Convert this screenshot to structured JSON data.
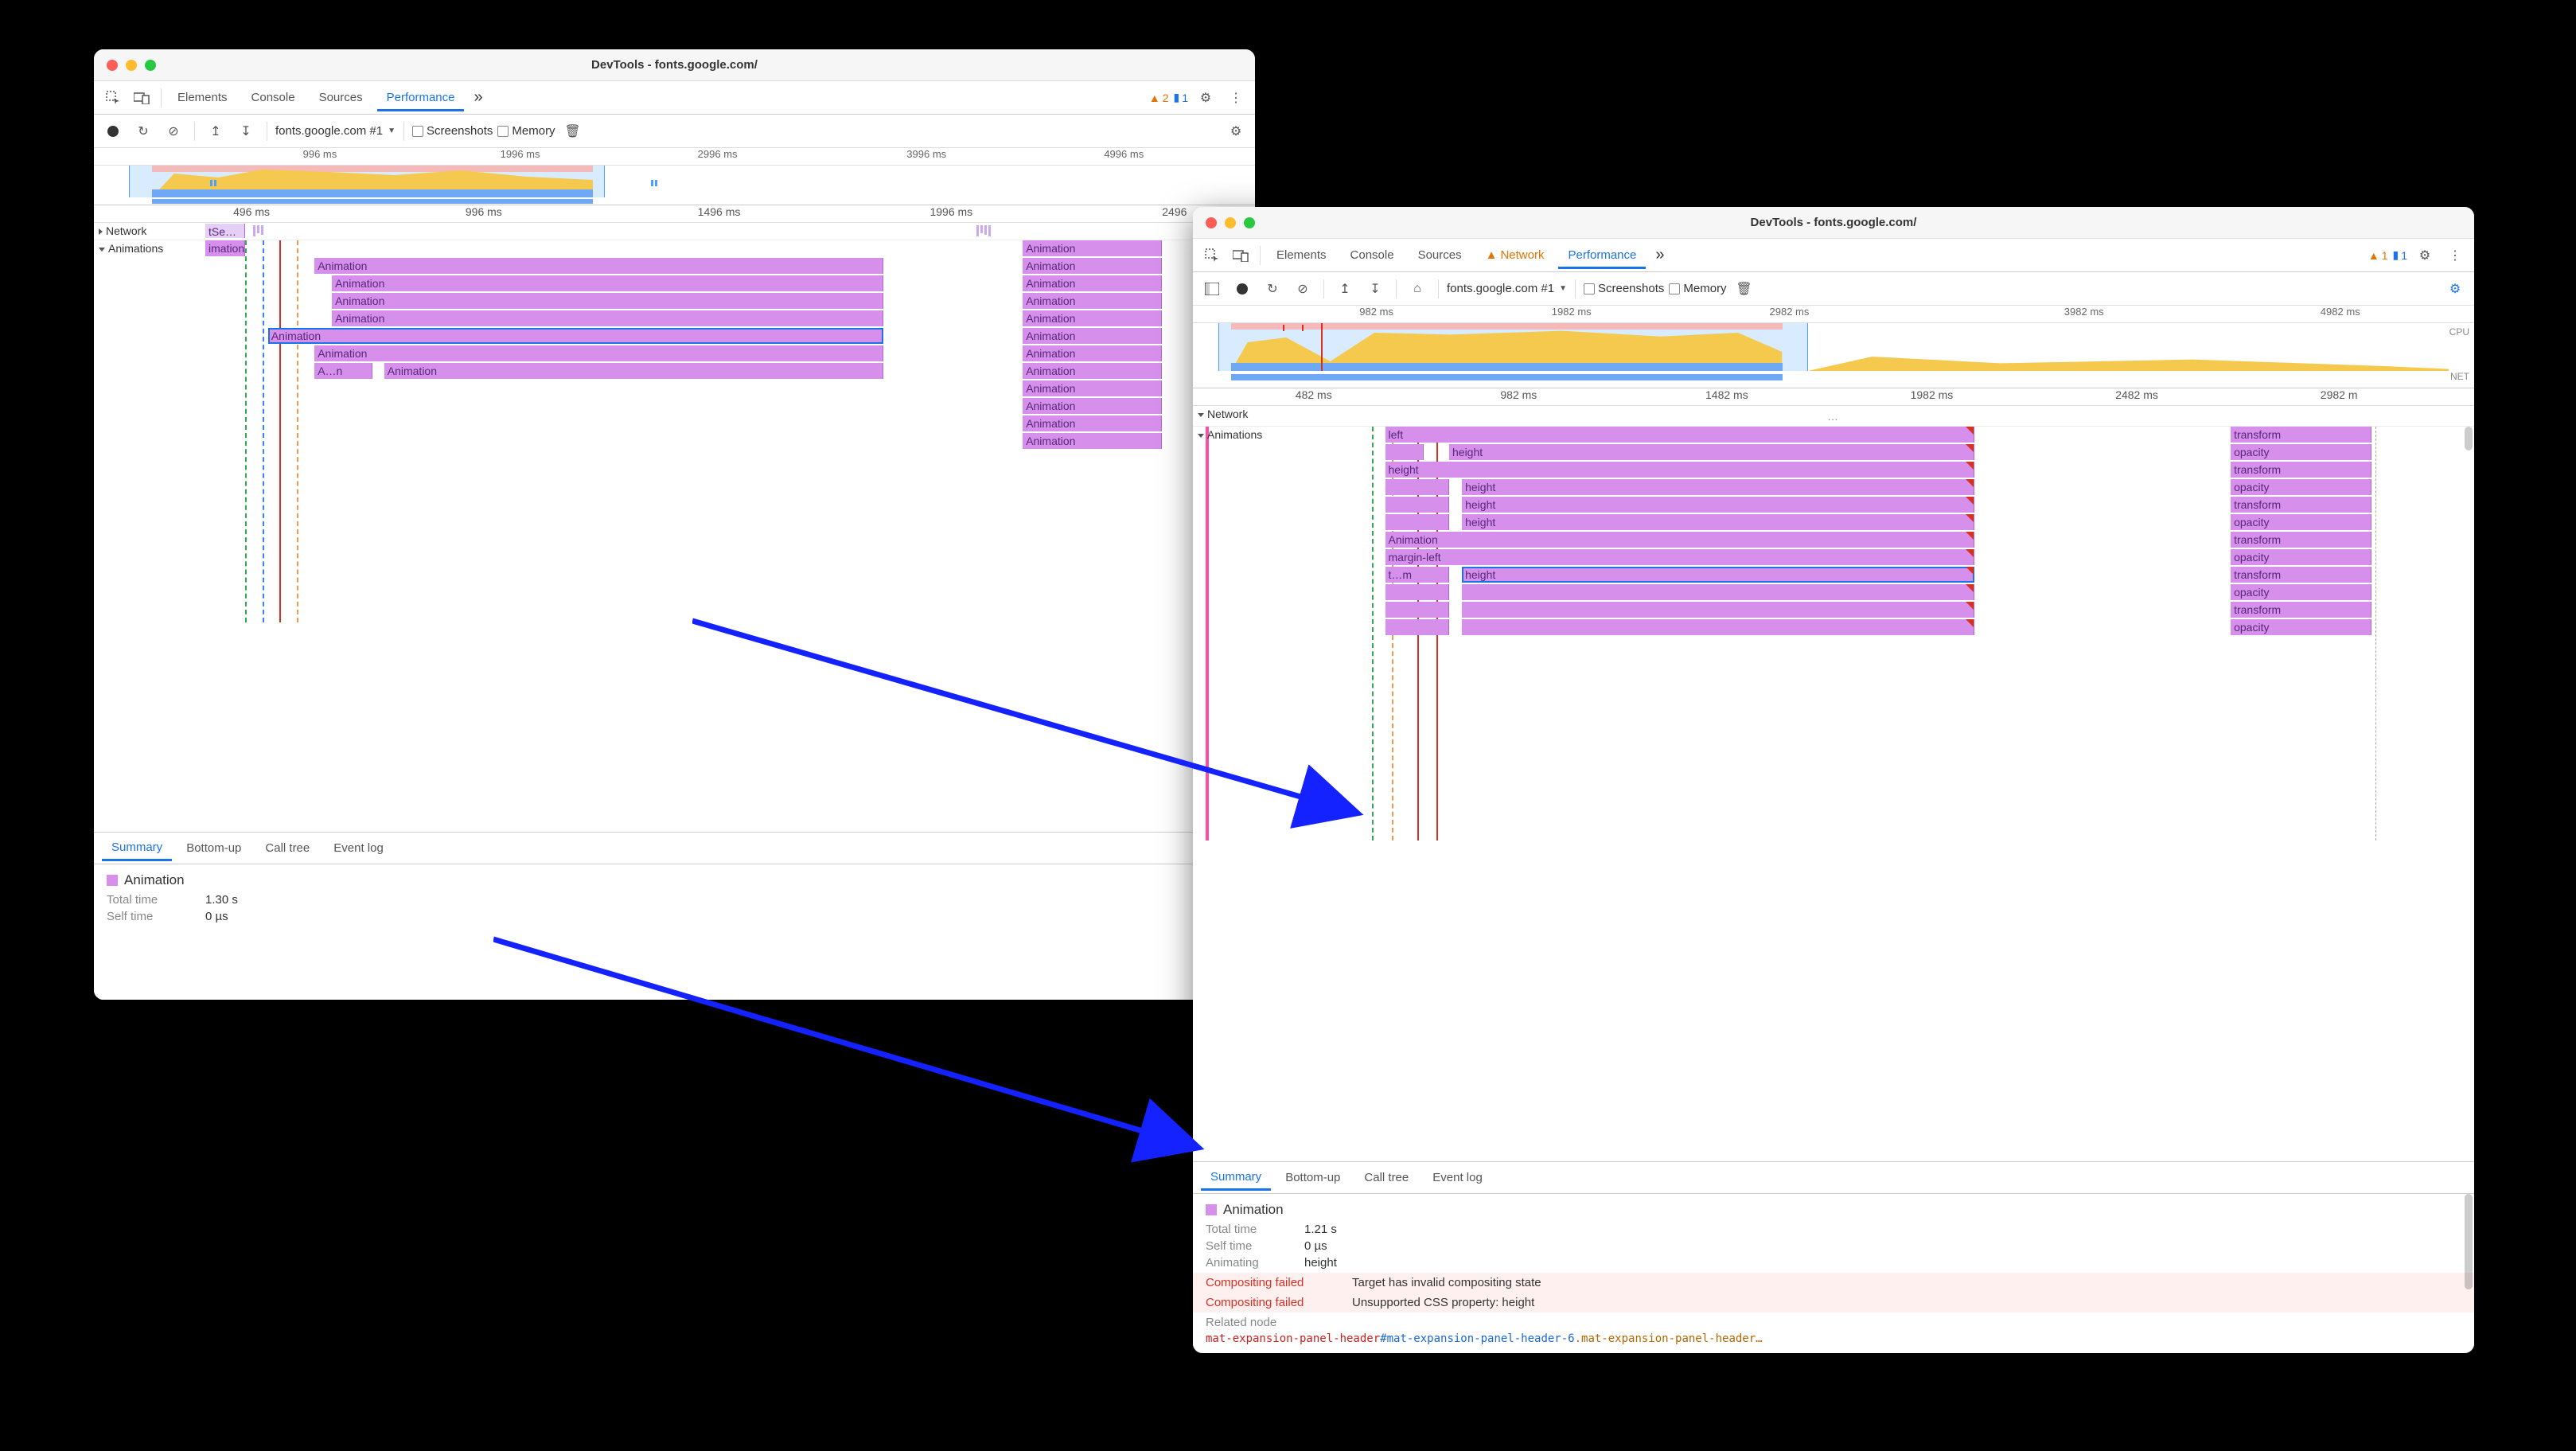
{
  "windows": {
    "left": {
      "title": "DevTools - fonts.google.com/",
      "tabs": {
        "elements": "Elements",
        "console": "Console",
        "sources": "Sources",
        "performance": "Performance",
        "more": "»"
      },
      "warn_count": "2",
      "chat_count": "1",
      "toolbar": {
        "profile": "fonts.google.com #1",
        "screenshots": "Screenshots",
        "memory": "Memory"
      },
      "overview_ruler": [
        "996 ms",
        "1996 ms",
        "2996 ms",
        "3996 ms",
        "4996 ms"
      ],
      "main_ruler": [
        "496 ms",
        "996 ms",
        "1496 ms",
        "1996 ms",
        "2496"
      ],
      "tracks": {
        "network": "Network",
        "net_item": "tSe…",
        "animations": "Animations",
        "anim_hdr_tail": "imation"
      },
      "anim_generic": "Animation",
      "anim_short": "A…n",
      "detail_tabs": {
        "summary": "Summary",
        "bottom": "Bottom-up",
        "calltree": "Call tree",
        "eventlog": "Event log"
      },
      "detail": {
        "title": "Animation",
        "total_k": "Total time",
        "total_v": "1.30 s",
        "self_k": "Self time",
        "self_v": "0 µs"
      }
    },
    "right": {
      "title": "DevTools - fonts.google.com/",
      "tabs": {
        "elements": "Elements",
        "console": "Console",
        "sources": "Sources",
        "network": "Network",
        "performance": "Performance",
        "more": "»"
      },
      "warn_count": "1",
      "chat_count": "1",
      "toolbar": {
        "profile": "fonts.google.com #1",
        "screenshots": "Screenshots",
        "memory": "Memory"
      },
      "overview_ruler": [
        "982 ms",
        "1982 ms",
        "2982 ms",
        "3982 ms",
        "4982 ms"
      ],
      "overview_labels": {
        "cpu": "CPU",
        "net": "NET"
      },
      "main_ruler": [
        "482 ms",
        "982 ms",
        "1482 ms",
        "1982 ms",
        "2482 ms",
        "2982 m"
      ],
      "tracks": {
        "network": "Network",
        "animations": "Animations"
      },
      "anim_rows_left": [
        "left",
        "height",
        "height",
        "height",
        "height",
        "height",
        "Animation",
        "margin-left",
        "t…m",
        "height"
      ],
      "anim_rows_right": [
        "transform",
        "opacity",
        "transform",
        "opacity",
        "transform",
        "opacity",
        "transform",
        "opacity",
        "transform",
        "opacity",
        "transform",
        "opacity"
      ],
      "detail_tabs": {
        "summary": "Summary",
        "bottom": "Bottom-up",
        "calltree": "Call tree",
        "eventlog": "Event log"
      },
      "detail": {
        "title": "Animation",
        "total_k": "Total time",
        "total_v": "1.21 s",
        "self_k": "Self time",
        "self_v": "0 µs",
        "animating_k": "Animating",
        "animating_v": "height",
        "cf_k": "Compositing failed",
        "cf_v1": "Target has invalid compositing state",
        "cf_v2": "Unsupported CSS property: height",
        "related_k": "Related node",
        "node_tag": "mat-expansion-panel-header",
        "node_id": "#mat-expansion-panel-header-6",
        "node_class": ".mat-expansion-panel-header…"
      }
    }
  }
}
